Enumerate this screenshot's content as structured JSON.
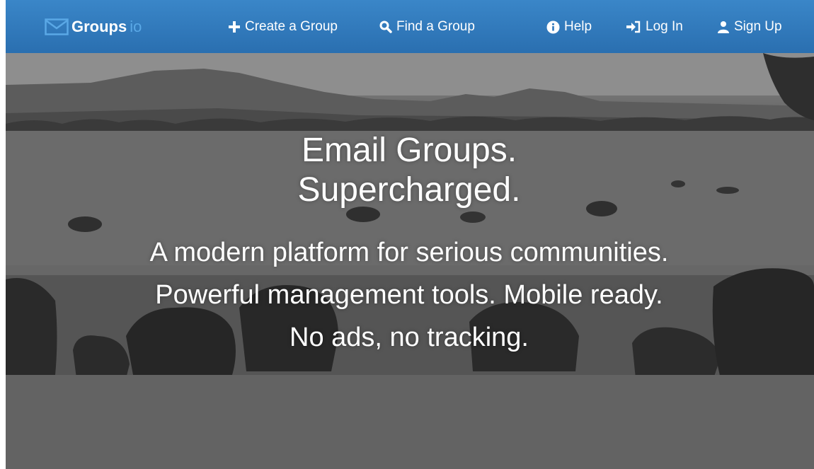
{
  "navbar": {
    "brand": {
      "name": "Groups",
      "tld": "io",
      "icon": "envelope-icon"
    },
    "links": [
      {
        "label": "Create a Group",
        "icon": "plus-icon"
      },
      {
        "label": "Find a Group",
        "icon": "search-icon"
      },
      {
        "label": "Help",
        "icon": "info-circle-icon"
      },
      {
        "label": "Log In",
        "icon": "sign-in-icon"
      },
      {
        "label": "Sign Up",
        "icon": "user-icon"
      }
    ],
    "colors": {
      "bar": "#2f78bd",
      "brand_accent": "#5aa8e6"
    }
  },
  "hero": {
    "headline_line1": "Email Groups.",
    "headline_line2": "Supercharged.",
    "tagline": "A modern platform for serious communities. Powerful management tools. Mobile ready. No ads, no tracking."
  }
}
